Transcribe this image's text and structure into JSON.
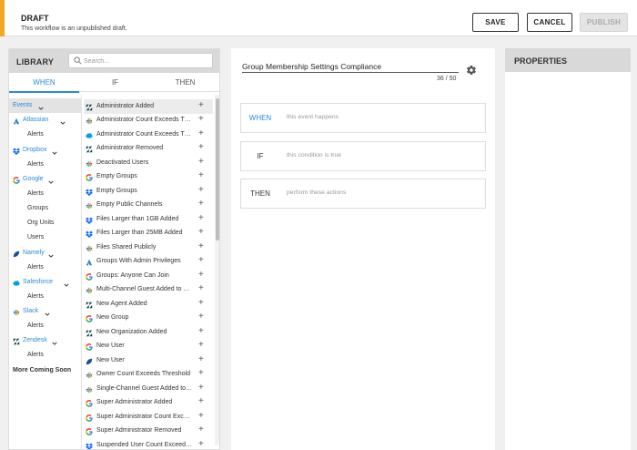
{
  "banner": {
    "title": "DRAFT",
    "subtitle": "This workflow is an unpublished draft.",
    "save": "SAVE",
    "cancel": "CANCEL",
    "publish": "PUBLISH"
  },
  "library": {
    "title": "LIBRARY",
    "search_placeholder": "Search...",
    "tabs": [
      "WHEN",
      "IF",
      "THEN"
    ],
    "providers": [
      {
        "type": "head",
        "label": "Events",
        "icon": "none"
      },
      {
        "type": "head",
        "label": "Atlassian",
        "icon": "atlassian-icon"
      },
      {
        "type": "sub",
        "label": "Alerts"
      },
      {
        "type": "head",
        "label": "Dropbox",
        "icon": "dropbox-icon"
      },
      {
        "type": "sub",
        "label": "Alerts"
      },
      {
        "type": "head",
        "label": "Google",
        "icon": "google-icon"
      },
      {
        "type": "sub",
        "label": "Alerts"
      },
      {
        "type": "sub",
        "label": "Groups"
      },
      {
        "type": "sub",
        "label": "Org Units"
      },
      {
        "type": "sub",
        "label": "Users"
      },
      {
        "type": "head",
        "label": "Namely",
        "icon": "namely-icon"
      },
      {
        "type": "sub",
        "label": "Alerts"
      },
      {
        "type": "head",
        "label": "Salesforce",
        "icon": "salesforce-icon"
      },
      {
        "type": "sub",
        "label": "Alerts"
      },
      {
        "type": "head",
        "label": "Slack",
        "icon": "slack-icon"
      },
      {
        "type": "sub",
        "label": "Alerts"
      },
      {
        "type": "head",
        "label": "Zendesk",
        "icon": "zendesk-icon"
      },
      {
        "type": "sub",
        "label": "Alerts"
      },
      {
        "type": "more",
        "label": "More Coming Soon"
      }
    ],
    "events": [
      {
        "label": "Administrator Added",
        "icon": "zendesk-icon"
      },
      {
        "label": "Administrator Count Exceeds Threshold",
        "icon": "slack-icon"
      },
      {
        "label": "Administrator Count Exceeds Threshold",
        "icon": "salesforce-icon"
      },
      {
        "label": "Administrator Removed",
        "icon": "zendesk-icon"
      },
      {
        "label": "Deactivated Users",
        "icon": "slack-icon"
      },
      {
        "label": "Empty Groups",
        "icon": "google-icon"
      },
      {
        "label": "Empty Groups",
        "icon": "dropbox-icon"
      },
      {
        "label": "Empty Public Channels",
        "icon": "slack-icon"
      },
      {
        "label": "Files Larger than 1GB Added",
        "icon": "dropbox-icon"
      },
      {
        "label": "Files Larger than 25MB Added",
        "icon": "dropbox-icon"
      },
      {
        "label": "Files Shared Publicly",
        "icon": "slack-icon"
      },
      {
        "label": "Groups With Admin Privileges",
        "icon": "atlassian-icon"
      },
      {
        "label": "Groups: Anyone Can Join",
        "icon": "google-icon"
      },
      {
        "label": "Multi-Channel Guest Added to Workspace",
        "icon": "slack-icon"
      },
      {
        "label": "New Agent Added",
        "icon": "zendesk-icon"
      },
      {
        "label": "New Group",
        "icon": "google-icon"
      },
      {
        "label": "New Organization Added",
        "icon": "zendesk-icon"
      },
      {
        "label": "New User",
        "icon": "google-icon"
      },
      {
        "label": "New User",
        "icon": "namely-icon"
      },
      {
        "label": "Owner Count Exceeds Threshold",
        "icon": "slack-icon"
      },
      {
        "label": "Single-Channel Guest Added to Workspace",
        "icon": "slack-icon"
      },
      {
        "label": "Super Administrator Added",
        "icon": "google-icon"
      },
      {
        "label": "Super Administrator Count Exceeds Threshold",
        "icon": "google-icon"
      },
      {
        "label": "Super Administrator Removed",
        "icon": "google-icon"
      },
      {
        "label": "Suspended User Count Exceeds Threshold",
        "icon": "dropbox-icon"
      }
    ]
  },
  "workflow": {
    "name": "Group Membership Settings Compliance",
    "counter": "36 / 50",
    "when": {
      "keyword": "WHEN",
      "hint": "this event happens"
    },
    "if": {
      "keyword": "IF",
      "hint": "this condition is true"
    },
    "then": {
      "keyword": "THEN",
      "hint": "perform these actions"
    }
  },
  "properties": {
    "title": "PROPERTIES"
  },
  "colors": {
    "accent": "#2b8ad6",
    "draft_stripe": "#f5a623"
  }
}
